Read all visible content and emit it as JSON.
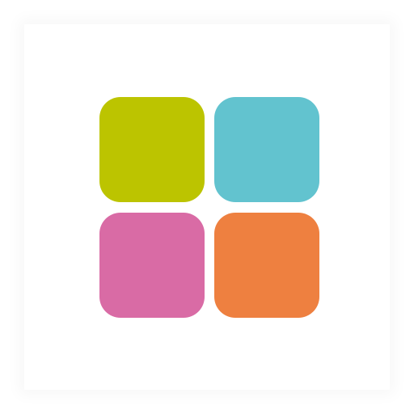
{
  "app_icon": {
    "name": "four-square-grid-icon",
    "background_color": "#ffffff",
    "tiles": [
      {
        "name": "top-left",
        "color": "#bcc400"
      },
      {
        "name": "top-right",
        "color": "#62c3cf"
      },
      {
        "name": "bottom-left",
        "color": "#d96ba5"
      },
      {
        "name": "bottom-right",
        "color": "#ee8040"
      }
    ]
  }
}
